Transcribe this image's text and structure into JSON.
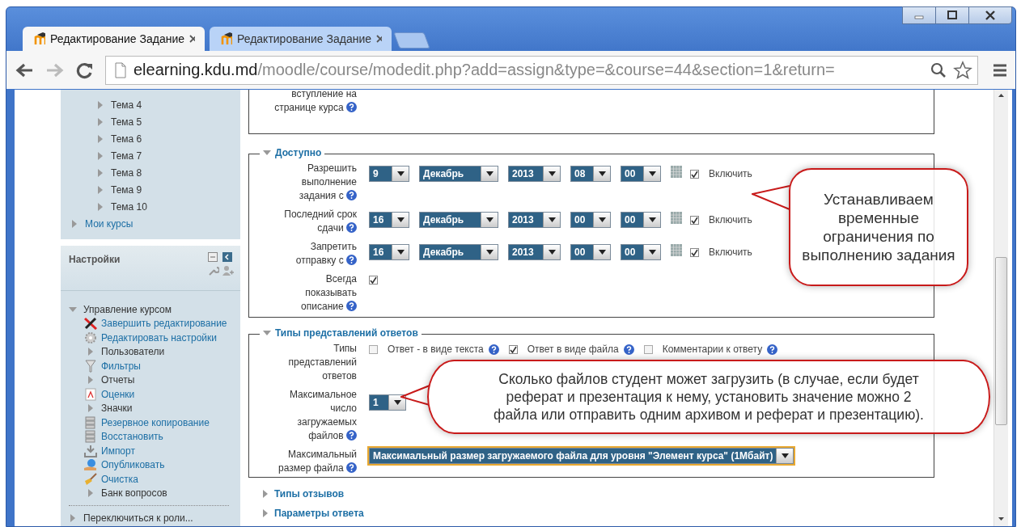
{
  "browser": {
    "tabs": [
      {
        "title": "Редактирование Задание",
        "selected": true
      },
      {
        "title": "Редактирование Задание",
        "selected": false
      }
    ],
    "url": {
      "host": "elearning.kdu.md",
      "path": "/moodle/course/modedit.php?add=assign&type=&course=44&section=1&return="
    }
  },
  "navigation": {
    "topics": [
      "Тема 4",
      "Тема 5",
      "Тема 6",
      "Тема 7",
      "Тема 8",
      "Тема 9",
      "Тема 10"
    ],
    "my_courses": "Мои курсы"
  },
  "settings": {
    "title": "Настройки",
    "course_admin": {
      "label": "Управление курсом",
      "expanded": true,
      "children": [
        {
          "label": "Завершить редактирование",
          "kind": "tools"
        },
        {
          "label": "Редактировать настройки",
          "kind": "gear"
        },
        {
          "label": "Пользователи",
          "kind": "folder"
        },
        {
          "label": "Фильтры",
          "kind": "filter"
        },
        {
          "label": "Отчеты",
          "kind": "folder"
        },
        {
          "label": "Оценки",
          "kind": "document"
        },
        {
          "label": "Значки",
          "kind": "folder"
        },
        {
          "label": "Резервное копирование",
          "kind": "backup"
        },
        {
          "label": "Восстановить",
          "kind": "backup"
        },
        {
          "label": "Импорт",
          "kind": "import"
        },
        {
          "label": "Опубликовать",
          "kind": "publish"
        },
        {
          "label": "Очистка",
          "kind": "broom"
        },
        {
          "label": "Банк вопросов",
          "kind": "folder"
        }
      ]
    },
    "switch_role": "Переключиться к роли..."
  },
  "form": {
    "intro_label": "вступление на странице курса",
    "availability": {
      "legend": "Доступно",
      "expanded": true,
      "rows": [
        {
          "label": "Разрешить выполнение задания с",
          "day": "9",
          "month": "Декабрь",
          "year": "2013",
          "hour": "08",
          "minute": "00",
          "enabled": true,
          "enable_label": "Включить"
        },
        {
          "label": "Последний срок сдачи",
          "day": "16",
          "month": "Декабрь",
          "year": "2013",
          "hour": "00",
          "minute": "00",
          "enabled": true,
          "enable_label": "Включить"
        },
        {
          "label": "Запретить отправку с",
          "day": "16",
          "month": "Декабрь",
          "year": "2013",
          "hour": "00",
          "minute": "00",
          "enabled": true,
          "enable_label": "Включить"
        }
      ],
      "always_show": {
        "label": "Всегда показывать описание",
        "checked": true
      }
    },
    "submission": {
      "legend": "Типы представлений ответов",
      "expanded": true,
      "types_label": "Типы представлений ответов",
      "types": [
        {
          "label": "Ответ - в виде текста",
          "checked": false
        },
        {
          "label": "Ответ в виде файла",
          "checked": true
        },
        {
          "label": "Комментарии к ответу",
          "checked": false
        }
      ],
      "max_files": {
        "label": "Максимальное число загружаемых файлов",
        "value": "1"
      },
      "max_size": {
        "label": "Максимальный размер файла",
        "value": "Максимальный размер загружаемого файла для уровня \"Элемент курса\" (1Мбайт)"
      }
    },
    "collapsed_sections": [
      {
        "legend": "Типы отзывов",
        "expanded": false
      },
      {
        "legend": "Параметры ответа",
        "expanded": false
      }
    ]
  },
  "callouts": [
    {
      "text": "Устанавливаем временные ограничения по выполнению задания"
    },
    {
      "text": "Сколько файлов студент может загрузить (в случае, если будет реферат и презентация к нему, установить значение можно 2 файла или отправить одним архивом и реферат и презентацию)."
    }
  ]
}
